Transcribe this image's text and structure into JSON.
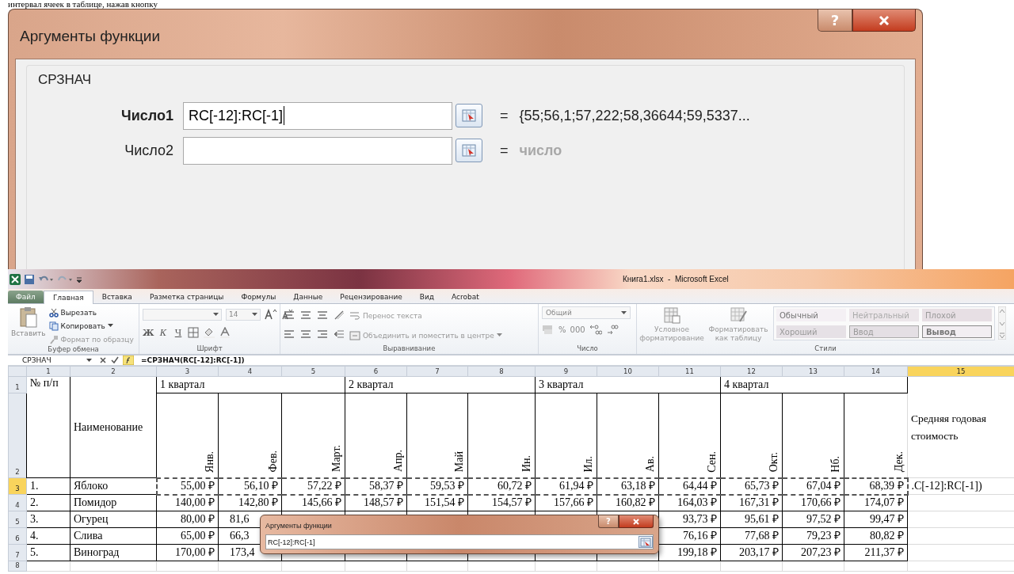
{
  "document_text": "интервал ячеек в таблице, нажав кнопку",
  "large_dialog": {
    "title": "Аргументы функции",
    "help": "?",
    "function_name": "СРЗНАЧ",
    "arguments": [
      {
        "label": "Число1",
        "bold": true,
        "value": "RC[-12]:RC[-1]",
        "equals": "=",
        "result": "{55;56,1;57,222;58,36644;59,5337...",
        "result_muted": false
      },
      {
        "label": "Число2",
        "bold": false,
        "equals": "=",
        "result": "число",
        "result_muted": true
      }
    ]
  },
  "excel": {
    "title": "Книга1.xlsx  -  Microsoft Excel",
    "tabs": [
      {
        "label": "Файл",
        "kind": "file",
        "selected": false
      },
      {
        "label": "Главная",
        "kind": "tab",
        "selected": true
      },
      {
        "label": "Вставка",
        "kind": "tab",
        "selected": false
      },
      {
        "label": "Разметка страницы",
        "kind": "tab",
        "selected": false
      },
      {
        "label": "Формулы",
        "kind": "tab",
        "selected": false
      },
      {
        "label": "Данные",
        "kind": "tab",
        "selected": false
      },
      {
        "label": "Рецензирование",
        "kind": "tab",
        "selected": false
      },
      {
        "label": "Вид",
        "kind": "tab",
        "selected": false
      },
      {
        "label": "Acrobat",
        "kind": "tab",
        "selected": false
      }
    ],
    "ribbon": {
      "clipboard": {
        "paste": "Вставить",
        "cut": "Вырезать",
        "copy": "Копировать",
        "format_painter": "Формат по образцу",
        "label": "Буфер обмена"
      },
      "font": {
        "size": "14",
        "bold": "Ж",
        "italic": "К",
        "underline": "Ч",
        "label": "Шрифт"
      },
      "alignment": {
        "wrap": "Перенос текста",
        "merge": "Объединить и поместить в центре",
        "label": "Выравнивание"
      },
      "number": {
        "format": "Общий",
        "percent": "%",
        "thousands": "000",
        "label": "Число"
      },
      "styles": {
        "conditional": "Условное форматирование",
        "as_table": "Форматировать как таблицу",
        "cells": [
          {
            "label": "Обычный",
            "kind": "normal"
          },
          {
            "label": "Нейтральный",
            "kind": "neutral"
          },
          {
            "label": "Плохой",
            "kind": "bad"
          },
          {
            "label": "Хороший",
            "kind": "good"
          },
          {
            "label": "Ввод",
            "kind": "input"
          },
          {
            "label": "Вывод",
            "kind": "output"
          }
        ],
        "label": "Стили"
      }
    },
    "name_box": "СРЗНАЧ",
    "formula": "=СРЗНАЧ(RC[-12]:RC[-1])",
    "columns": [
      {
        "label": "1",
        "selected": false
      },
      {
        "label": "2",
        "selected": false
      },
      {
        "label": "3",
        "selected": false
      },
      {
        "label": "4",
        "selected": false
      },
      {
        "label": "5",
        "selected": false
      },
      {
        "label": "6",
        "selected": false
      },
      {
        "label": "7",
        "selected": false
      },
      {
        "label": "8",
        "selected": false
      },
      {
        "label": "9",
        "selected": false
      },
      {
        "label": "10",
        "selected": false
      },
      {
        "label": "11",
        "selected": false
      },
      {
        "label": "12",
        "selected": false
      },
      {
        "label": "13",
        "selected": false
      },
      {
        "label": "14",
        "selected": false
      },
      {
        "label": "15",
        "selected": true
      }
    ],
    "row_numbers": [
      {
        "label": "1",
        "selected": false
      },
      {
        "label": "2",
        "selected": false
      },
      {
        "label": "3",
        "selected": true
      },
      {
        "label": "4",
        "selected": false
      },
      {
        "label": "5",
        "selected": false
      },
      {
        "label": "6",
        "selected": false
      },
      {
        "label": "7",
        "selected": false
      },
      {
        "label": "8",
        "selected": false
      }
    ],
    "header": {
      "number": "№ п/п",
      "name": "Наименование",
      "average": "Средняя годовая стоимость",
      "quarters": [
        {
          "label": "1 квартал",
          "months": [
            "Янв.",
            "Фев.",
            "Март."
          ]
        },
        {
          "label": "2 квартал",
          "months": [
            "Апр.",
            "Май",
            "Ин."
          ]
        },
        {
          "label": "3 квартал",
          "months": [
            "Ил.",
            "Ав.",
            "Сен."
          ]
        },
        {
          "label": "4 квартал",
          "months": [
            "Окт.",
            "Нб.",
            "Дек."
          ]
        }
      ]
    },
    "data_rows": [
      {
        "number": "1.",
        "name": "Яблоко",
        "in_range": true,
        "average": ".C[-12]:RC[-1])",
        "values": [
          "55,00 ₽",
          "56,10 ₽",
          "57,22 ₽",
          "58,37 ₽",
          "59,53 ₽",
          "60,72 ₽",
          "61,94 ₽",
          "63,18 ₽",
          "64,44 ₽",
          "65,73 ₽",
          "67,04 ₽",
          "68,39 ₽"
        ]
      },
      {
        "number": "2.",
        "name": "Помидор",
        "in_range": false,
        "values": [
          "140,00 ₽",
          "142,80 ₽",
          "145,66 ₽",
          "148,57 ₽",
          "151,54 ₽",
          "154,57 ₽",
          "157,66 ₽",
          "160,82 ₽",
          "164,03 ₽",
          "167,31 ₽",
          "170,66 ₽",
          "174,07 ₽"
        ]
      },
      {
        "number": "3.",
        "name": "Огурец",
        "in_range": false,
        "last_value_cut": true,
        "values": [
          "80,00 ₽",
          "81,6"
        ],
        "values_end": [
          "93,73 ₽",
          "95,61 ₽",
          "97,52 ₽",
          "99,47 ₽"
        ]
      },
      {
        "number": "4.",
        "name": "Слива",
        "in_range": false,
        "last_value_cut": true,
        "values": [
          "65,00 ₽",
          "66,3"
        ],
        "values_end": [
          "76,16 ₽",
          "77,68 ₽",
          "79,23 ₽",
          "80,82 ₽"
        ]
      },
      {
        "number": "5.",
        "name": "Виноград",
        "in_range": false,
        "last_value_cut": true,
        "values": [
          "170,00 ₽",
          "173,4"
        ],
        "values_end": [
          "199,18 ₽",
          "203,17 ₽",
          "207,23 ₽",
          "211,37 ₽"
        ]
      }
    ],
    "small_dialog": {
      "title": "Аргументы функции",
      "help": "?",
      "value": "RC[-12]:RC[-1]"
    }
  }
}
